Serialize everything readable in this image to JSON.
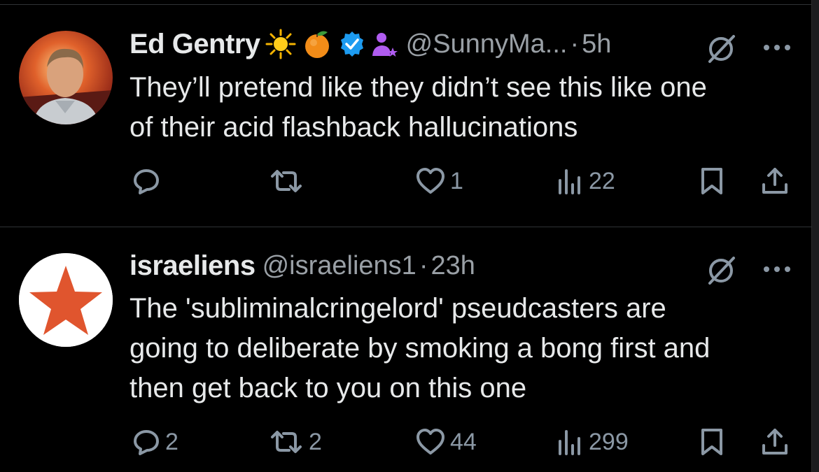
{
  "tweets": [
    {
      "name": "Ed Gentry",
      "handle": "@SunnyMa...",
      "separator": "·",
      "time": "5h",
      "lines": [
        "They’ll pretend like they didn’t see this like one",
        "of their acid flashback hallucinations"
      ],
      "badges": [
        "sun-emoji",
        "orange-emoji",
        "verified-badge-icon",
        "person-star-icon"
      ],
      "reply_count": "",
      "retweet_count": "",
      "like_count": "1",
      "view_count": "22"
    },
    {
      "name": "israeliens",
      "handle": "@israeliens1",
      "separator": "·",
      "time": "23h",
      "lines": [
        "The 'subliminalcringelord' pseudcasters are",
        "going to deliberate by smoking a bong first and",
        "then get back to you on this one"
      ],
      "reply_count": "2",
      "retweet_count": "2",
      "like_count": "44",
      "view_count": "299"
    }
  ],
  "colors": {
    "background": "#000000",
    "text": "#e7e9ea",
    "muted": "#8b98a5",
    "verified": "#1d9bf0",
    "avatar_star": "#e0552e",
    "person_icon": "#b05cf0"
  },
  "icons": [
    "reply-icon",
    "retweet-icon",
    "like-icon",
    "views-icon",
    "bookmark-icon",
    "share-icon",
    "grok-icon",
    "more-icon"
  ]
}
